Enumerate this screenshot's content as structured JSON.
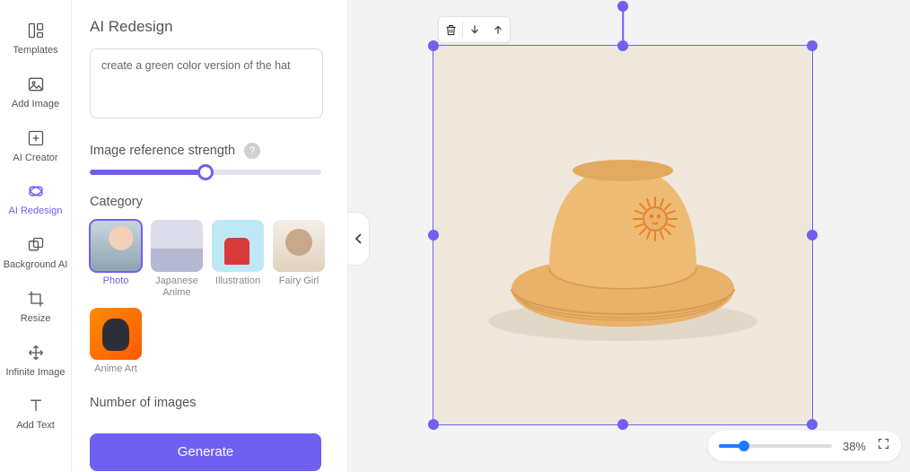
{
  "sidebar": {
    "items": [
      {
        "label": "Templates"
      },
      {
        "label": "Add Image"
      },
      {
        "label": "AI Creator"
      },
      {
        "label": "AI Redesign"
      },
      {
        "label": "Background AI"
      },
      {
        "label": "Resize"
      },
      {
        "label": "Infinite Image"
      },
      {
        "label": "Add Text"
      }
    ]
  },
  "panel": {
    "title": "AI Redesign",
    "prompt_value": "create a green color version of the hat",
    "strength_label": "Image reference strength",
    "strength_value_pct": 50,
    "category_label": "Category",
    "categories": [
      {
        "label": "Photo",
        "selected": true
      },
      {
        "label": "Japanese Anime",
        "selected": false
      },
      {
        "label": "Illustration",
        "selected": false
      },
      {
        "label": "Fairy Girl",
        "selected": false
      },
      {
        "label": "Anime Art",
        "selected": false
      }
    ],
    "num_images_label": "Number of images",
    "generate_label": "Generate"
  },
  "canvas": {
    "zoom_pct": 38,
    "zoom_label": "38%"
  }
}
